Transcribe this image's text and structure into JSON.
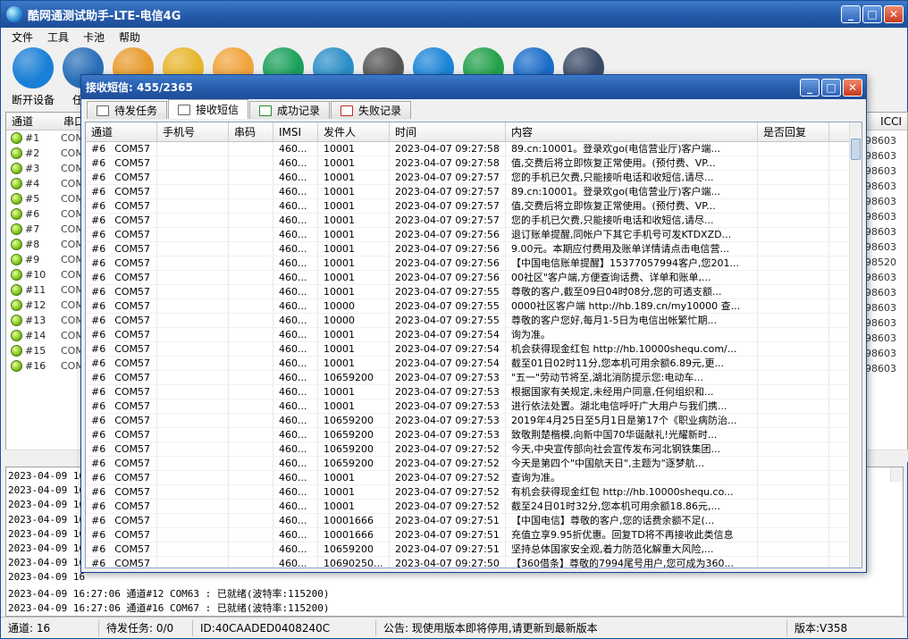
{
  "app": {
    "title": "酷网通测试助手-LTE-电信4G",
    "menu": [
      "文件",
      "工具",
      "卡池",
      "帮助"
    ],
    "toolbar": [
      {
        "icon": "antenna-icon",
        "label": "断开设备",
        "color": "#1a7fd6"
      },
      {
        "icon": "gear-icon",
        "label": "任务",
        "color": "#2a6fb8"
      },
      {
        "icon": "document-icon",
        "label": "",
        "color": "#e89a2c"
      },
      {
        "icon": "sms-icon",
        "label": "",
        "color": "#e8b52c"
      },
      {
        "icon": "mail-icon",
        "label": "",
        "color": "#f0a33a"
      },
      {
        "icon": "phone-icon",
        "label": "",
        "color": "#1aa05a"
      },
      {
        "icon": "atom-icon",
        "label": "",
        "color": "#2a8ec8"
      },
      {
        "icon": "camera-icon",
        "label": "",
        "color": "#555555"
      },
      {
        "icon": "refresh-icon",
        "label": "",
        "color": "#1a84d6"
      },
      {
        "icon": "location-icon",
        "label": "",
        "color": "#23a04a"
      },
      {
        "icon": "tools-icon",
        "label": "",
        "color": "#1a6cc8"
      },
      {
        "icon": "exit-icon",
        "label": "",
        "color": "#3a4a66"
      }
    ],
    "grid_headers": [
      "通道",
      "串口"
    ],
    "grid_right_header": "ICCI",
    "channels": [
      "#1",
      "#2",
      "#3",
      "#4",
      "#5",
      "#6",
      "#7",
      "#8",
      "#9",
      "#10",
      "#11",
      "#12",
      "#13",
      "#14",
      "#15",
      "#16"
    ],
    "com_label": "COM",
    "iccid_prefix": [
      "898603",
      "898603",
      "898603",
      "898603",
      "898603",
      "898603",
      "898603",
      "898603",
      "898520",
      "898603",
      "898603",
      "898603",
      "898603",
      "898603",
      "898603",
      "898603"
    ],
    "log_lines": [
      "2023-04-09 16",
      "2023-04-09 16",
      "2023-04-09 16",
      "2023-04-09 16",
      "2023-04-09 16",
      "2023-04-09 16",
      "2023-04-09 16",
      "2023-04-09 16",
      "2023-04-09 16:27:06 通道#12  COM63 : 已就绪(波特率:115200)",
      "2023-04-09 16:27:06 通道#16  COM67 : 已就绪(波特率:115200)"
    ],
    "status": {
      "channels": "通道: 16",
      "pending": "待发任务: 0/0",
      "id": "ID:40CAADED0408240C",
      "notice": "公告: 现使用版本即将停用,请更新到最新版本",
      "version": "版本:V358"
    }
  },
  "sms_window": {
    "title": "接收短信: 455/2365",
    "tabs": [
      "待发任务",
      "接收短信",
      "成功记录",
      "失败记录"
    ],
    "active_tab": 1,
    "columns": [
      "通道",
      "手机号",
      "串码",
      "IMSI",
      "发件人",
      "时间",
      "内容",
      "是否回复"
    ],
    "rows": [
      [
        "#6",
        "COM57",
        "460...",
        "10001",
        "2023-04-07 09:27:58",
        "89.cn:10001。登录欢go(电信营业厅)客户端..."
      ],
      [
        "#6",
        "COM57",
        "460...",
        "10001",
        "2023-04-07 09:27:58",
        "值,交费后将立即恢复正常使用。(预付费、VP..."
      ],
      [
        "#6",
        "COM57",
        "460...",
        "10001",
        "2023-04-07 09:27:57",
        "您的手机已欠费,只能接听电话和收短信,请尽..."
      ],
      [
        "#6",
        "COM57",
        "460...",
        "10001",
        "2023-04-07 09:27:57",
        "89.cn:10001。登录欢go(电信营业厅)客户端..."
      ],
      [
        "#6",
        "COM57",
        "460...",
        "10001",
        "2023-04-07 09:27:57",
        "值,交费后将立即恢复正常使用。(预付费、VP..."
      ],
      [
        "#6",
        "COM57",
        "460...",
        "10001",
        "2023-04-07 09:27:57",
        "您的手机已欠费,只能接听电话和收短信,请尽..."
      ],
      [
        "#6",
        "COM57",
        "460...",
        "10001",
        "2023-04-07 09:27:56",
        "退订账单提醒,同帐户下其它手机号可发KTDXZD..."
      ],
      [
        "#6",
        "COM57",
        "460...",
        "10001",
        "2023-04-07 09:27:56",
        "9.00元。本期应付费用及账单详情请点击电信营..."
      ],
      [
        "#6",
        "COM57",
        "460...",
        "10001",
        "2023-04-07 09:27:56",
        "【中国电信账单提醒】15377057994客户,您201..."
      ],
      [
        "#6",
        "COM57",
        "460...",
        "10001",
        "2023-04-07 09:27:56",
        "00社区\"客户端,方便查询话费、详单和账单,..."
      ],
      [
        "#6",
        "COM57",
        "460...",
        "10001",
        "2023-04-07 09:27:55",
        "尊敬的客户,截至09日04时08分,您的可透支额..."
      ],
      [
        "#6",
        "COM57",
        "460...",
        "10000",
        "2023-04-07 09:27:55",
        "0000社区客户端 http://hb.189.cn/my10000 查..."
      ],
      [
        "#6",
        "COM57",
        "460...",
        "10000",
        "2023-04-07 09:27:55",
        "尊敬的客户您好,每月1-5日为电信出帐繁忙期..."
      ],
      [
        "#6",
        "COM57",
        "460...",
        "10001",
        "2023-04-07 09:27:54",
        "询为准。"
      ],
      [
        "#6",
        "COM57",
        "460...",
        "10001",
        "2023-04-07 09:27:54",
        "机会获得现金红包 http://hb.10000shequ.com/..."
      ],
      [
        "#6",
        "COM57",
        "460...",
        "10001",
        "2023-04-07 09:27:54",
        "截至01日02时11分,您本机可用余额6.89元,更..."
      ],
      [
        "#6",
        "COM57",
        "460...",
        "10659200",
        "2023-04-07 09:27:53",
        "\"五一\"劳动节将至,湖北消防提示您:电动车..."
      ],
      [
        "#6",
        "COM57",
        "460...",
        "10001",
        "2023-04-07 09:27:53",
        "根据国家有关规定,未经用户同意,任何组织和..."
      ],
      [
        "#6",
        "COM57",
        "460...",
        "10001",
        "2023-04-07 09:27:53",
        "进行依法处置。湖北电信呼吁广大用户与我们携..."
      ],
      [
        "#6",
        "COM57",
        "460...",
        "10659200",
        "2023-04-07 09:27:53",
        "2019年4月25日至5月1日是第17个《职业病防治..."
      ],
      [
        "#6",
        "COM57",
        "460...",
        "10659200",
        "2023-04-07 09:27:53",
        "致敬荆楚楷模,向新中国70华诞献礼!光耀新时..."
      ],
      [
        "#6",
        "COM57",
        "460...",
        "10659200",
        "2023-04-07 09:27:52",
        "今天,中央宣传部向社会宣传发布河北钢铁集团..."
      ],
      [
        "#6",
        "COM57",
        "460...",
        "10659200",
        "2023-04-07 09:27:52",
        "今天是第四个\"中国航天日\",主题为\"逐梦航..."
      ],
      [
        "#6",
        "COM57",
        "460...",
        "10001",
        "2023-04-07 09:27:52",
        "查询为准。"
      ],
      [
        "#6",
        "COM57",
        "460...",
        "10001",
        "2023-04-07 09:27:52",
        "有机会获得现金红包 http://hb.10000shequ.co..."
      ],
      [
        "#6",
        "COM57",
        "460...",
        "10001",
        "2023-04-07 09:27:52",
        "截至24日01时32分,您本机可用余额18.86元,..."
      ],
      [
        "#6",
        "COM57",
        "460...",
        "10001666",
        "2023-04-07 09:27:51",
        "【中国电信】尊敬的客户,您的话费余额不足(..."
      ],
      [
        "#6",
        "COM57",
        "460...",
        "10001666",
        "2023-04-07 09:27:51",
        "充值立享9.95折优惠。回复TD将不再接收此类信息"
      ],
      [
        "#6",
        "COM57",
        "460...",
        "10659200",
        "2023-04-07 09:27:51",
        "坚持总体国家安全观,着力防范化解重大风险,..."
      ],
      [
        "#6",
        "COM57",
        "460...",
        "10690250...",
        "2023-04-07 09:27:50",
        "【360借条】尊敬的7994尾号用户,您可成为360..."
      ]
    ]
  }
}
